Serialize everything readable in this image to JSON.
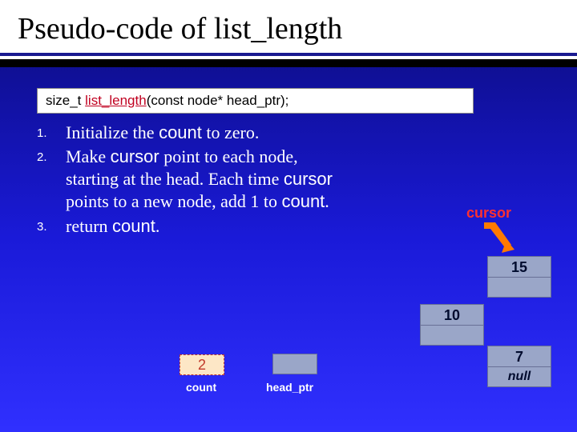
{
  "title": "Pseudo-code of list_length",
  "signature": {
    "ret": "size_t ",
    "fn": "list_length",
    "args": "(const node* head_ptr);"
  },
  "steps": [
    {
      "n": "1.",
      "html": "Initialize the <span class='mono'>count</span> to zero."
    },
    {
      "n": "2.",
      "html": "Make <span class='mono'>cursor</span> point to each node, starting at the head. Each time <span class='mono'>cursor</span> points to a new node, add 1 to <span class='mono'>count</span>."
    },
    {
      "n": "3.",
      "html": "return <span class='mono'>count</span>."
    }
  ],
  "diagram": {
    "cursor_label": "cursor",
    "count_value": "2",
    "count_label": "count",
    "headptr_label": "head_ptr",
    "nodes": [
      {
        "value": "10"
      },
      {
        "value": "15"
      },
      {
        "value": "7",
        "null": "null"
      }
    ]
  }
}
